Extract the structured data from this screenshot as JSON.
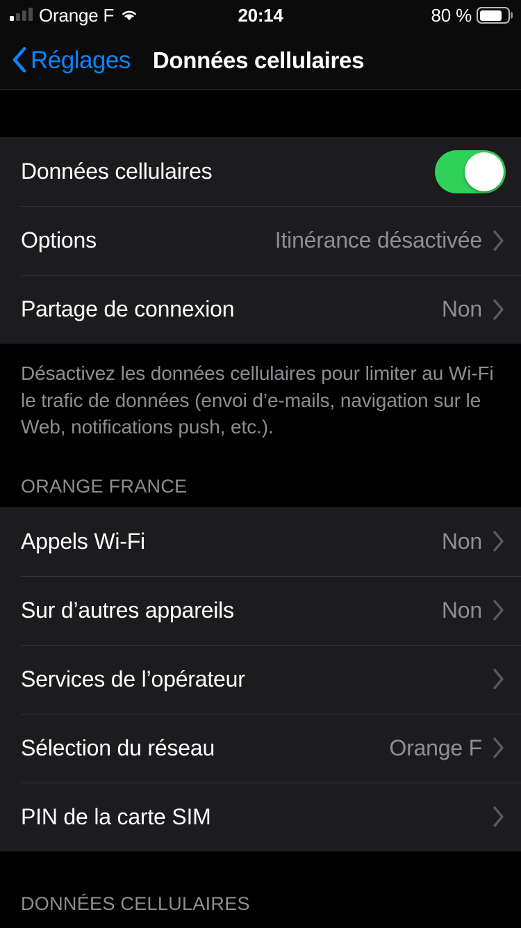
{
  "status_bar": {
    "carrier": "Orange F",
    "time": "20:14",
    "battery_percent": "80 %",
    "battery_level": 80,
    "signal_bars_active": 1,
    "signal_bars_total": 4,
    "wifi_icon": "wifi-icon",
    "battery_icon": "battery-icon"
  },
  "nav": {
    "back_label": "Réglages",
    "back_icon": "chevron-left-icon",
    "title": "Données cellulaires"
  },
  "group_one": {
    "rows": [
      {
        "label": "Données cellulaires",
        "control": "toggle",
        "toggle_on": true,
        "name": "cellular-data-row"
      },
      {
        "label": "Options",
        "value": "Itinérance désactivée",
        "control": "disclosure",
        "name": "options-row"
      },
      {
        "label": "Partage de connexion",
        "value": "Non",
        "control": "disclosure",
        "name": "personal-hotspot-row"
      }
    ],
    "footer": "Désactivez les données cellulaires pour limiter au Wi-Fi le trafic de données (envoi d’e-mails, navigation sur le Web, notifications push, etc.)."
  },
  "group_two": {
    "header": "ORANGE FRANCE",
    "rows": [
      {
        "label": "Appels Wi-Fi",
        "value": "Non",
        "control": "disclosure",
        "name": "wifi-calling-row"
      },
      {
        "label": "Sur d’autres appareils",
        "value": "Non",
        "control": "disclosure",
        "name": "other-devices-row"
      },
      {
        "label": "Services de l’opérateur",
        "value": "",
        "control": "disclosure",
        "name": "carrier-services-row"
      },
      {
        "label": "Sélection du réseau",
        "value": "Orange F",
        "control": "disclosure",
        "name": "network-selection-row"
      },
      {
        "label": "PIN de la carte SIM",
        "value": "",
        "control": "disclosure",
        "name": "sim-pin-row"
      }
    ]
  },
  "group_three": {
    "header": "DONNÉES CELLULAIRES"
  },
  "colors": {
    "background": "#000000",
    "card": "#1c1c1e",
    "separator": "#38383a",
    "accent_blue": "#0a84ff",
    "toggle_green": "#30d158",
    "secondary_text": "#8e8e93",
    "primary_text": "#ffffff"
  }
}
